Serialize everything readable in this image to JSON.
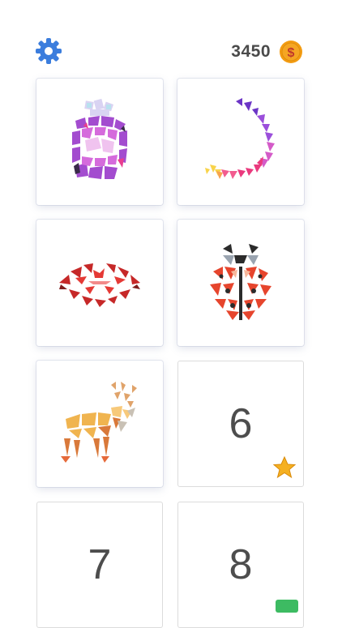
{
  "header": {
    "settings_icon": "gear-icon",
    "coin_count": "3450",
    "coin_icon": "dollar-coin-icon",
    "accent_color": "#3a7bd5",
    "coin_color": "#f39c12"
  },
  "levels": [
    {
      "id": "perfume",
      "icon": "perfume-bottle-art"
    },
    {
      "id": "moon",
      "icon": "crescent-moon-art"
    },
    {
      "id": "lips",
      "icon": "lips-art"
    },
    {
      "id": "ladybug",
      "icon": "ladybug-art"
    },
    {
      "id": "deer",
      "icon": "deer-art"
    },
    {
      "number": "6",
      "badge": "star-icon"
    },
    {
      "number": "7"
    },
    {
      "number": "8",
      "badge": "cash-icon"
    }
  ]
}
